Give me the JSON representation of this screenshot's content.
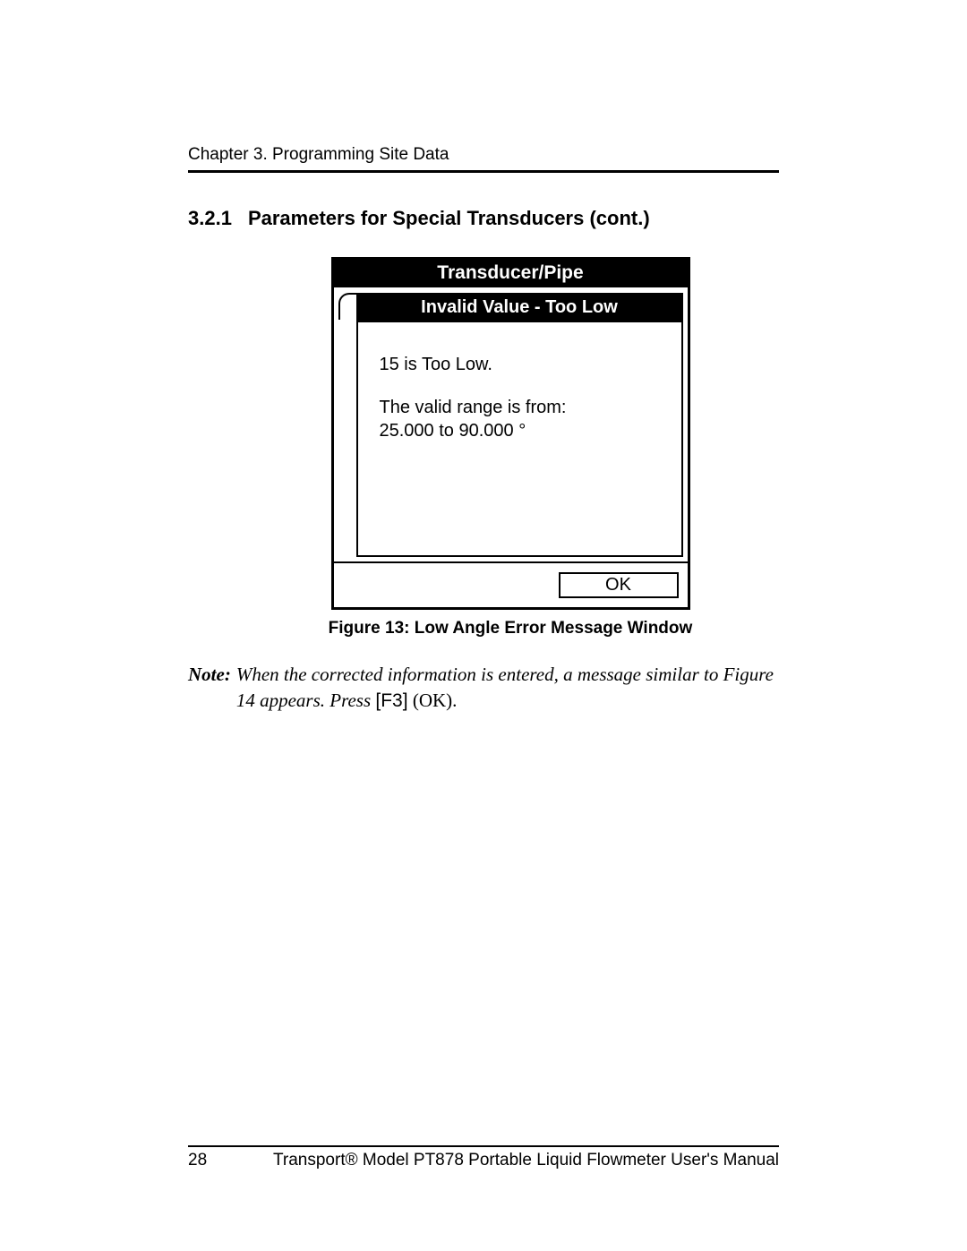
{
  "header": {
    "running": "Chapter 3. Programming Site Data"
  },
  "section": {
    "number": "3.2.1",
    "title": "Parameters for Special Transducers (cont.)"
  },
  "device": {
    "outer_title": "Transducer/Pipe",
    "inner_title": "Invalid Value - Too Low",
    "msg_line1": "15 is Too Low.",
    "msg_line2": "The valid range is from:",
    "msg_line3": " 25.000 to 90.000 °",
    "ok_label": "OK"
  },
  "figure": {
    "caption": "Figure 13: Low Angle Error Message Window"
  },
  "note": {
    "label": "Note:",
    "body_a": "When the corrected information is entered, a message similar to Figure 14 appears. Press ",
    "key": "[F3]",
    "body_b": " (OK)."
  },
  "footer": {
    "page": "28",
    "title": "Transport® Model PT878 Portable Liquid Flowmeter User's Manual"
  }
}
